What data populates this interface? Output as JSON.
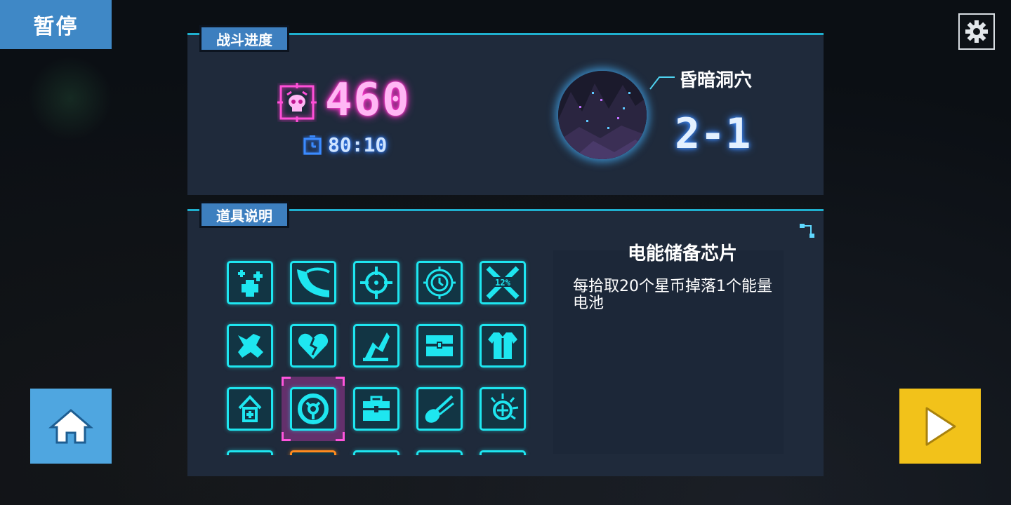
{
  "pause": {
    "label": "暂停"
  },
  "settings": {
    "icon": "gear-icon"
  },
  "battle": {
    "title": "战斗进度",
    "kills": "460",
    "timer": "80:10",
    "stage_name": "昏暗洞穴",
    "stage_number": "2-1"
  },
  "items": {
    "title": "道具说明",
    "selected_index": 11,
    "slots": [
      {
        "icon": "plus-cluster-icon"
      },
      {
        "icon": "speed-swoosh-icon"
      },
      {
        "icon": "crosshair-icon"
      },
      {
        "icon": "clock-target-icon"
      },
      {
        "icon": "crossed-swords-12-icon",
        "label": "12%"
      },
      {
        "icon": "x-blob-icon"
      },
      {
        "icon": "broken-heart-icon"
      },
      {
        "icon": "flame-shard-icon"
      },
      {
        "icon": "treasure-chest-icon"
      },
      {
        "icon": "armor-vest-icon"
      },
      {
        "icon": "up-arrow-plus-icon"
      },
      {
        "icon": "energy-chip-icon"
      },
      {
        "icon": "medkit-icon"
      },
      {
        "icon": "comet-icon"
      },
      {
        "icon": "spiked-target-icon"
      }
    ],
    "description": {
      "title": "电能储备芯片",
      "text": "每拾取20个星币掉落1个能量电池"
    }
  },
  "buttons": {
    "home": "home-icon",
    "play": "play-icon"
  },
  "colors": {
    "panel": "#1f2a3b",
    "accent_cyan": "#1ee6f0",
    "kills_pink": "#ff33cc",
    "play_yellow": "#f2c21a",
    "home_blue": "#4fa6e0"
  }
}
